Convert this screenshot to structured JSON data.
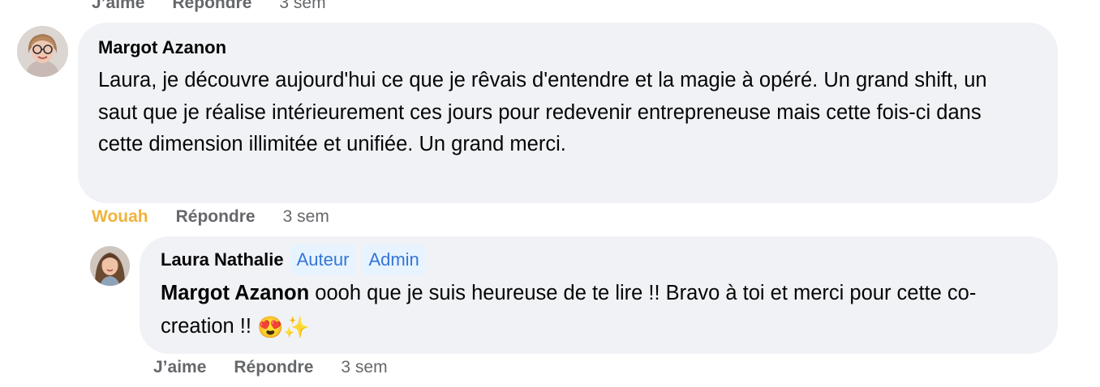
{
  "top_actions": {
    "like": "J’aime",
    "reply": "Répondre",
    "time": "3 sem"
  },
  "comment1": {
    "author": "Margot Azanon",
    "text": "Laura, je découvre aujourd'hui ce que je rêvais d'entendre et la magie à opéré. Un grand shift, un saut que je réalise intérieurement ces jours pour redevenir entrepreneuse mais cette fois-ci dans cette dimension illimitée et unifiée. Un grand merci.",
    "reaction": "Wouah",
    "reply": "Répondre",
    "time": "3 sem"
  },
  "comment2": {
    "author": "Laura Nathalie",
    "badges": [
      "Auteur",
      "Admin"
    ],
    "mention": "Margot Azanon",
    "text": " oooh que je suis heureuse de te lire !! Bravo à toi et merci pour cette co-creation !! ",
    "emojis": "😍✨",
    "like": "J’aime",
    "reply": "Répondre",
    "time": "3 sem"
  },
  "colors": {
    "bubble": "#f0f2f5",
    "secondary_text": "#65676b",
    "reaction": "#f0b33c",
    "badge_bg": "#e7f3ff",
    "badge_text": "#3576d6"
  },
  "icons": {
    "avatar1": "avatar-woman-glasses",
    "avatar2": "avatar-woman-curly-hair"
  }
}
